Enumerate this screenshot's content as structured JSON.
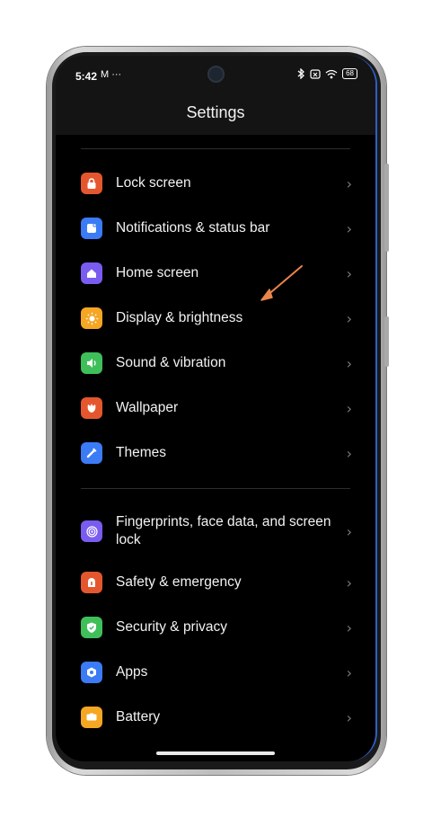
{
  "status_bar": {
    "time": "5:42",
    "left_icons": "M ···",
    "right_icons": [
      "bluetooth-icon",
      "sim-icon",
      "wifi-icon"
    ],
    "battery": "68"
  },
  "header": {
    "title": "Settings"
  },
  "groups": [
    {
      "items": [
        {
          "label": "Lock screen",
          "icon": "lock-icon",
          "color": "#e4572e"
        },
        {
          "label": "Notifications & status bar",
          "icon": "notification-icon",
          "color": "#3b7bf6"
        },
        {
          "label": "Home screen",
          "icon": "home-icon",
          "color": "#7a5cf0"
        },
        {
          "label": "Display & brightness",
          "icon": "sun-icon",
          "color": "#f5a623"
        },
        {
          "label": "Sound & vibration",
          "icon": "speaker-icon",
          "color": "#3fbf5a"
        },
        {
          "label": "Wallpaper",
          "icon": "flower-icon",
          "color": "#e4572e"
        },
        {
          "label": "Themes",
          "icon": "brush-icon",
          "color": "#3b7bf6"
        }
      ]
    },
    {
      "items": [
        {
          "label": "Fingerprints, face data, and screen lock",
          "icon": "fingerprint-icon",
          "color": "#7a5cf0"
        },
        {
          "label": "Safety & emergency",
          "icon": "safety-icon",
          "color": "#e4572e"
        },
        {
          "label": "Security & privacy",
          "icon": "shield-icon",
          "color": "#3fbf5a"
        },
        {
          "label": "Apps",
          "icon": "apps-icon",
          "color": "#3b7bf6"
        },
        {
          "label": "Battery",
          "icon": "battery-icon",
          "color": "#f5a623"
        }
      ]
    }
  ],
  "chevron": "›",
  "annotation_arrow": {
    "color": "#e8854a",
    "points_to": "Display & brightness"
  }
}
